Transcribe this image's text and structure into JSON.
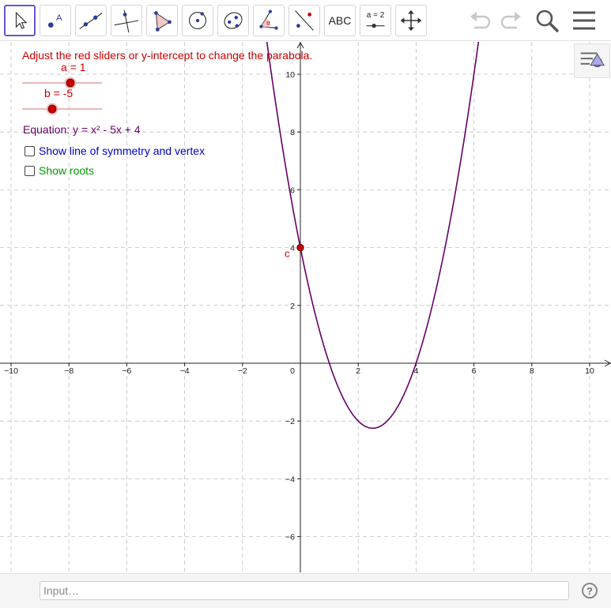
{
  "toolbar": {
    "tools": [
      {
        "name": "move-tool",
        "icon": "arrow-cursor-icon"
      },
      {
        "name": "point-tool",
        "icon": "point-icon"
      },
      {
        "name": "line-tool",
        "icon": "line-through-points-icon"
      },
      {
        "name": "perpendicular-line-tool",
        "icon": "perpendicular-line-icon"
      },
      {
        "name": "polygon-tool",
        "icon": "polygon-icon"
      },
      {
        "name": "circle-tool",
        "icon": "circle-center-point-icon"
      },
      {
        "name": "conic-tool",
        "icon": "ellipse-icon"
      },
      {
        "name": "angle-tool",
        "icon": "angle-icon"
      },
      {
        "name": "reflect-tool",
        "icon": "reflect-about-line-icon"
      },
      {
        "name": "text-tool",
        "icon": "text-icon",
        "label": "ABC"
      },
      {
        "name": "slider-tool",
        "icon": "slider-icon",
        "label": "a = 2"
      },
      {
        "name": "move-graphics-view-tool",
        "icon": "move-arrows-icon"
      }
    ],
    "right_icons": [
      "undo-icon",
      "redo-icon",
      "search-icon",
      "menu-icon"
    ]
  },
  "instruction": "Adjust the red sliders or y-intercept to change the parabola.",
  "sliders": [
    {
      "name": "a",
      "label": "a = 1",
      "value": 1
    },
    {
      "name": "b",
      "label": "b = -5",
      "value": -5
    }
  ],
  "equation": "Equation:  y = x² - 5x + 4",
  "checkboxes": [
    {
      "label": "Show line of symmetry and vertex",
      "checked": false,
      "color": "#0000cc"
    },
    {
      "label": "Show roots",
      "checked": false,
      "color": "#009900"
    }
  ],
  "point": {
    "label": "c",
    "x": 0,
    "y": 4,
    "color": "#cc0000"
  },
  "chart_data": {
    "type": "line",
    "title": "",
    "function": "y = x² - 5x + 4",
    "coefficients": {
      "a": 1,
      "b": -5,
      "c": 4
    },
    "xlim": [
      -10.5,
      10.7
    ],
    "ylim": [
      -7.2,
      11.2
    ],
    "x_ticks": [
      -10,
      -8,
      -6,
      -4,
      -2,
      0,
      2,
      4,
      6,
      8,
      10
    ],
    "y_ticks": [
      -6,
      -4,
      -2,
      2,
      4,
      6,
      8,
      10
    ],
    "x_tick_labels": [
      "−10",
      "−8",
      "−6",
      "−4",
      "−2",
      "0",
      "2",
      "4",
      "6",
      "8",
      "10"
    ],
    "y_tick_labels": [
      "−6",
      "−4",
      "−2",
      "2",
      "4",
      "6",
      "8",
      "10"
    ],
    "grid": true,
    "curve_color": "#660066",
    "series": [
      {
        "x": [
          -1.5,
          -1,
          0,
          1,
          1.5,
          2,
          2.5,
          3,
          3.5,
          4,
          5,
          6,
          6.5
        ],
        "y": [
          13.75,
          10,
          4,
          0,
          -1.25,
          -2,
          -2.25,
          -2,
          -1.25,
          0,
          4,
          10,
          13.75
        ]
      }
    ]
  },
  "input": {
    "placeholder": "Input…"
  },
  "help_label": "?",
  "colors": {
    "accent": "#6557d2",
    "slider": "#cc0000",
    "grid": "#c0c0c0"
  }
}
